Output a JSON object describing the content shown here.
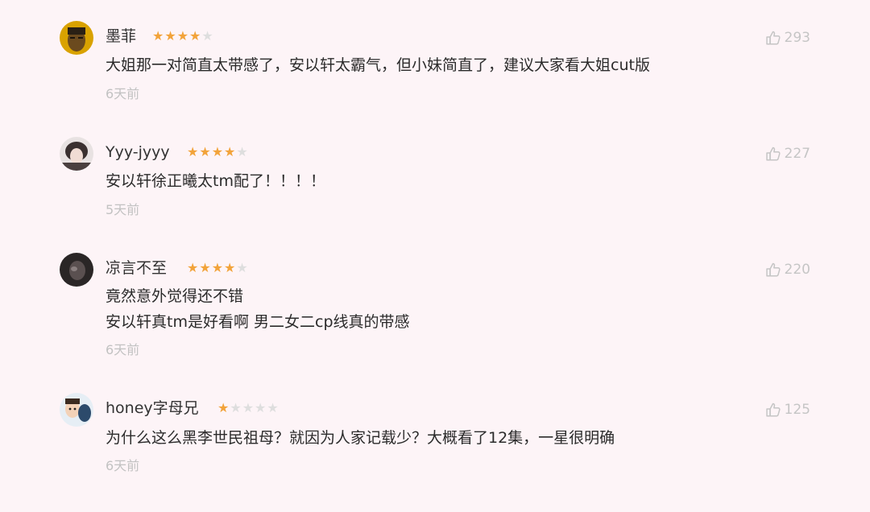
{
  "colors": {
    "background": "#fdf4f7",
    "star_filled": "#f2a33a",
    "star_empty": "#dedede",
    "muted": "#c2c2c2"
  },
  "comments": [
    {
      "username": "墨菲",
      "rating": 4,
      "likes": "293",
      "text": [
        "大姐那一对简直太带感了，安以轩太霸气，但小妹简直了，建议大家看大姐cut版"
      ],
      "time": "6天前",
      "avatar_icon": "avatar-icon"
    },
    {
      "username": "Yyy-jyyy",
      "rating": 4,
      "likes": "227",
      "text": [
        "安以轩徐正曦太tm配了！！！！"
      ],
      "time": "5天前",
      "avatar_icon": "avatar-icon"
    },
    {
      "username": "凉言不至",
      "rating": 4,
      "likes": "220",
      "text": [
        "竟然意外觉得还不错",
        "安以轩真tm是好看啊 男二女二cp线真的带感"
      ],
      "time": "6天前",
      "avatar_icon": "avatar-icon"
    },
    {
      "username": "honey字母兄",
      "rating": 1,
      "likes": "125",
      "text": [
        "为什么这么黑李世民祖母？就因为人家记载少？大概看了12集，一星很明确"
      ],
      "time": "6天前",
      "avatar_icon": "avatar-icon"
    }
  ]
}
